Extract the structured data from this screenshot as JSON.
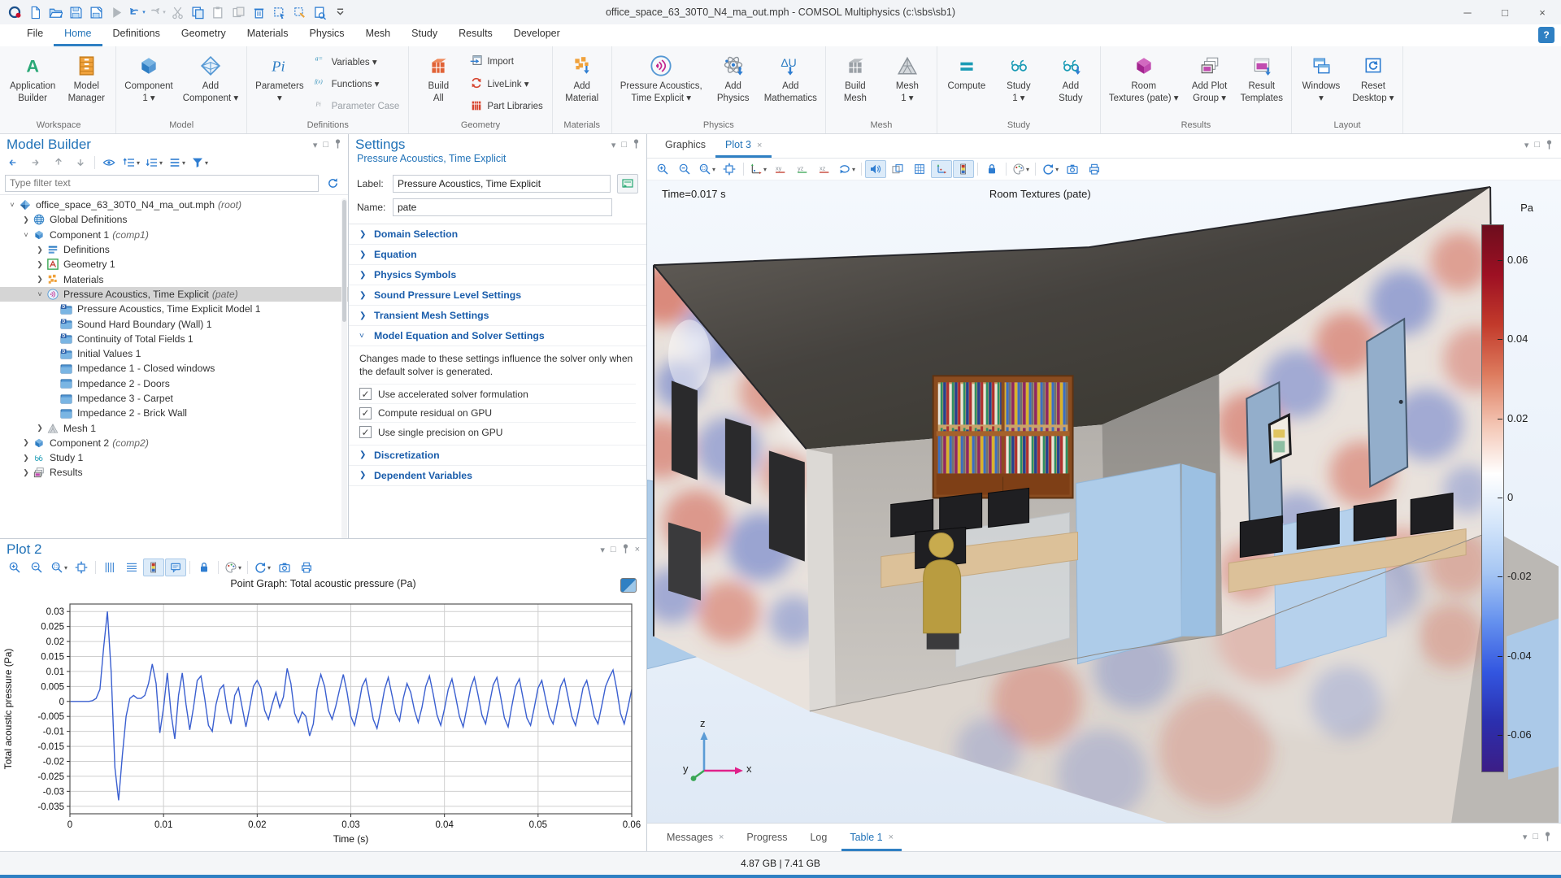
{
  "window": {
    "title": "office_space_63_30T0_N4_ma_out.mph - COMSOL Multiphysics (c:\\sbs\\sb1)",
    "controls": [
      "minimize",
      "maximize",
      "close"
    ],
    "quick_icons": [
      {
        "icon": "comsol-logo"
      },
      {
        "icon": "new-file"
      },
      {
        "icon": "open-file"
      },
      {
        "icon": "save"
      },
      {
        "icon": "save-as"
      },
      {
        "icon": "run",
        "disabled": true
      },
      {
        "icon": "undo",
        "caret": true
      },
      {
        "icon": "redo",
        "caret": true,
        "disabled": true
      },
      {
        "icon": "cut",
        "disabled": true
      },
      {
        "icon": "copy"
      },
      {
        "icon": "paste",
        "disabled": true
      },
      {
        "icon": "duplicate",
        "disabled": true
      },
      {
        "icon": "delete"
      },
      {
        "icon": "select-box"
      },
      {
        "icon": "material-sweep"
      },
      {
        "icon": "preview"
      },
      {
        "icon": "toolbar-options",
        "dark": true
      }
    ]
  },
  "menu": {
    "items": [
      "File",
      "Home",
      "Definitions",
      "Geometry",
      "Materials",
      "Physics",
      "Mesh",
      "Study",
      "Results",
      "Developer"
    ],
    "active": "Home",
    "help": "?"
  },
  "ribbon": {
    "groups": [
      {
        "label": "Workspace",
        "buttons": [
          {
            "icon": "app-builder",
            "label": "Application\nBuilder"
          },
          {
            "icon": "model-manager",
            "label": "Model\nManager"
          }
        ]
      },
      {
        "label": "Model",
        "buttons": [
          {
            "icon": "component",
            "label": "Component\n1 ▾"
          },
          {
            "icon": "add-component",
            "label": "Add\nComponent ▾"
          }
        ]
      },
      {
        "label": "Definitions",
        "buttons": [
          {
            "icon": "parameters",
            "label": "Parameters\n▾"
          }
        ],
        "stack": [
          {
            "icon": "variables",
            "label": "Variables ▾"
          },
          {
            "icon": "functions",
            "label": "Functions ▾"
          },
          {
            "icon": "parameter-case",
            "label": "Parameter Case",
            "disabled": true
          }
        ]
      },
      {
        "label": "Geometry",
        "buttons": [
          {
            "icon": "build-all",
            "label": "Build\nAll"
          }
        ],
        "stack": [
          {
            "icon": "import",
            "label": "Import"
          },
          {
            "icon": "livelink",
            "label": "LiveLink ▾"
          },
          {
            "icon": "part-libraries",
            "label": "Part Libraries"
          }
        ]
      },
      {
        "label": "Materials",
        "buttons": [
          {
            "icon": "add-material",
            "label": "Add\nMaterial"
          }
        ]
      },
      {
        "label": "Physics",
        "buttons": [
          {
            "icon": "pressure-acoustics",
            "label": "Pressure Acoustics,\nTime Explicit ▾"
          },
          {
            "icon": "add-physics",
            "label": "Add\nPhysics"
          },
          {
            "icon": "add-mathematics",
            "label": "Add\nMathematics"
          }
        ]
      },
      {
        "label": "Mesh",
        "buttons": [
          {
            "icon": "build-mesh",
            "label": "Build\nMesh"
          },
          {
            "icon": "mesh",
            "label": "Mesh\n1 ▾"
          }
        ]
      },
      {
        "label": "Study",
        "buttons": [
          {
            "icon": "compute",
            "label": "Compute"
          },
          {
            "icon": "study",
            "label": "Study\n1 ▾"
          },
          {
            "icon": "add-study",
            "label": "Add\nStudy"
          }
        ]
      },
      {
        "label": "Results",
        "buttons": [
          {
            "icon": "room-textures",
            "label": "Room\nTextures (pate) ▾"
          },
          {
            "icon": "add-plot-group",
            "label": "Add Plot\nGroup ▾"
          },
          {
            "icon": "result-templates",
            "label": "Result\nTemplates"
          }
        ]
      },
      {
        "label": "Layout",
        "buttons": [
          {
            "icon": "windows",
            "label": "Windows\n▾"
          },
          {
            "icon": "reset-desktop",
            "label": "Reset\nDesktop ▾"
          }
        ]
      }
    ]
  },
  "model_builder": {
    "title": "Model Builder",
    "toolbar": [
      {
        "icon": "arrow-left"
      },
      {
        "icon": "arrow-right"
      },
      {
        "icon": "arrow-up"
      },
      {
        "icon": "arrow-down"
      },
      {
        "sep": true
      },
      {
        "icon": "eye"
      },
      {
        "icon": "list-up",
        "caret": true
      },
      {
        "icon": "list-down",
        "caret": true
      },
      {
        "icon": "columns",
        "caret": true
      },
      {
        "icon": "filter",
        "caret": true
      }
    ],
    "filter_placeholder": "Type filter text",
    "tree": [
      {
        "label": "office_space_63_30T0_N4_ma_out.mph",
        "suffix": "(root)",
        "level": 0,
        "expand": "v",
        "icon": "model-root"
      },
      {
        "label": "Global Definitions",
        "level": 1,
        "expand": ">",
        "icon": "globe"
      },
      {
        "label": "Component 1",
        "suffix": "(comp1)",
        "level": 1,
        "expand": "v",
        "icon": "component"
      },
      {
        "label": "Definitions",
        "level": 2,
        "expand": ">",
        "icon": "definitions"
      },
      {
        "label": "Geometry 1",
        "level": 2,
        "expand": ">",
        "icon": "geometry"
      },
      {
        "label": "Materials",
        "level": 2,
        "expand": ">",
        "icon": "materials"
      },
      {
        "label": "Pressure Acoustics, Time Explicit",
        "suffix": "(pate)",
        "level": 2,
        "expand": "v",
        "icon": "acoustics",
        "selected": true
      },
      {
        "label": "Pressure Acoustics, Time Explicit Model 1",
        "level": 3,
        "icon": "node-d"
      },
      {
        "label": "Sound Hard Boundary (Wall) 1",
        "level": 3,
        "icon": "node-d"
      },
      {
        "label": "Continuity of Total Fields 1",
        "level": 3,
        "icon": "node-d"
      },
      {
        "label": "Initial Values 1",
        "level": 3,
        "icon": "node-d"
      },
      {
        "label": "Impedance 1 - Closed windows",
        "level": 3,
        "icon": "node"
      },
      {
        "label": "Impedance 2 - Doors",
        "level": 3,
        "icon": "node"
      },
      {
        "label": "Impedance 3 - Carpet",
        "level": 3,
        "icon": "node"
      },
      {
        "label": "Impedance 2 - Brick Wall",
        "level": 3,
        "icon": "node"
      },
      {
        "label": "Mesh 1",
        "level": 2,
        "expand": ">",
        "icon": "mesh-tree"
      },
      {
        "label": "Component 2",
        "suffix": "(comp2)",
        "level": 1,
        "expand": ">",
        "icon": "component"
      },
      {
        "label": "Study 1",
        "level": 1,
        "expand": ">",
        "icon": "study-tree"
      },
      {
        "label": "Results",
        "level": 1,
        "expand": ">",
        "icon": "results-tree"
      }
    ]
  },
  "settings": {
    "title": "Settings",
    "subtitle": "Pressure Acoustics, Time Explicit",
    "label_field": {
      "label": "Label:",
      "value": "Pressure Acoustics, Time Explicit"
    },
    "name_field": {
      "label": "Name:",
      "value": "pate"
    },
    "sections": [
      {
        "label": "Domain Selection"
      },
      {
        "label": "Equation"
      },
      {
        "label": "Physics Symbols"
      },
      {
        "label": "Sound Pressure Level Settings"
      },
      {
        "label": "Transient Mesh Settings"
      },
      {
        "label": "Model Equation and Solver Settings",
        "expanded": true,
        "note": "Changes made to these settings influence the solver only when the default solver is generated.",
        "checkboxes": [
          {
            "label": "Use accelerated solver formulation",
            "checked": true
          },
          {
            "label": "Compute residual on GPU",
            "checked": true
          },
          {
            "label": "Use single precision on GPU",
            "checked": true
          }
        ]
      },
      {
        "label": "Discretization"
      },
      {
        "label": "Dependent Variables"
      }
    ]
  },
  "plot2": {
    "title": "Plot 2",
    "toolbar": [
      {
        "icon": "zoom-in"
      },
      {
        "icon": "zoom-out"
      },
      {
        "icon": "zoom-box",
        "caret": true
      },
      {
        "icon": "zoom-extents"
      },
      {
        "sep": true
      },
      {
        "icon": "grid-v"
      },
      {
        "icon": "grid-h"
      },
      {
        "icon": "color-legend",
        "active": true
      },
      {
        "icon": "plot-labels",
        "active": true
      },
      {
        "sep": true
      },
      {
        "icon": "lock"
      },
      {
        "sep": true
      },
      {
        "icon": "palette",
        "caret": true
      },
      {
        "sep": true
      },
      {
        "icon": "update",
        "caret": true
      },
      {
        "icon": "camera"
      },
      {
        "icon": "print"
      }
    ]
  },
  "chart_data": {
    "type": "line",
    "title": "Point Graph: Total acoustic pressure (Pa)",
    "xlabel": "Time (s)",
    "ylabel": "Total acoustic pressure (Pa)",
    "xlim": [
      0,
      0.06
    ],
    "ylim": [
      -0.0375,
      0.0325
    ],
    "xticks": [
      0,
      0.01,
      0.02,
      0.03,
      0.04,
      0.05,
      0.06
    ],
    "yticks": [
      0.03,
      0.025,
      0.02,
      0.015,
      0.01,
      0.005,
      0,
      -0.005,
      -0.01,
      -0.015,
      -0.02,
      -0.025,
      -0.03,
      -0.035
    ],
    "grid": true,
    "series": [
      {
        "name": "Total acoustic pressure",
        "color": "#3a5fd0",
        "t0": 0,
        "dt": 0.0004,
        "values": [
          0,
          0,
          0,
          0,
          0,
          0,
          0.0002,
          0.001,
          0.004,
          0.018,
          0.03,
          0.01,
          -0.022,
          -0.033,
          -0.018,
          -0.005,
          0.001,
          0.002,
          0.001,
          0.001,
          0.002,
          0.006,
          0.0125,
          0.006,
          -0.0105,
          -0.002,
          0.0095,
          -0.004,
          -0.0125,
          0.002,
          0.0095,
          -0.001,
          -0.0095,
          -0.002,
          0.007,
          0.0085,
          0.001,
          -0.008,
          -0.01,
          -0.001,
          0.004,
          0.0055,
          -0.003,
          -0.0075,
          0.002,
          0.0045,
          -0.002,
          -0.0085,
          -0.002,
          0.005,
          0.007,
          0.0045,
          -0.003,
          -0.006,
          -0.001,
          0.003,
          -0.002,
          0.0015,
          0.011,
          0.006,
          -0.004,
          -0.007,
          -0.0035,
          -0.005,
          -0.0115,
          -0.0075,
          0.004,
          0.009,
          0.005,
          -0.003,
          -0.006,
          -0.0015,
          0.004,
          0.009,
          0.003,
          -0.005,
          -0.008,
          -0.002,
          0.005,
          0.0075,
          0.001,
          -0.006,
          -0.009,
          -0.003,
          0.004,
          0.008,
          0.002,
          -0.004,
          -0.0065,
          0.001,
          0.006,
          0.003,
          -0.003,
          -0.007,
          -0.002,
          0.005,
          0.0085,
          0.0025,
          -0.0045,
          -0.008,
          -0.0025,
          0.004,
          0.0075,
          0.0015,
          -0.005,
          -0.0085,
          -0.002,
          0.0045,
          0.008,
          0.002,
          -0.0045,
          -0.0075,
          -0.001,
          0.0055,
          0.008,
          0.0015,
          -0.0055,
          -0.0085,
          -0.0015,
          0.005,
          0.0075,
          0.001,
          -0.0055,
          -0.008,
          -0.002,
          0.0045,
          0.007,
          0.001,
          -0.005,
          -0.0075,
          -0.0015,
          0.005,
          0.0075,
          0.0015,
          -0.005,
          -0.008,
          -0.002,
          0.0045,
          0.007,
          0.0015,
          -0.005,
          -0.0075,
          -0.0015,
          0.005,
          0.008,
          0.0105,
          0.004,
          -0.004,
          -0.0075,
          -0.002,
          0.004
        ]
      }
    ]
  },
  "graphics": {
    "tabs": [
      {
        "label": "Graphics"
      },
      {
        "label": "Plot 3",
        "active": true,
        "closable": true
      }
    ],
    "toolbar": [
      {
        "icon": "zoom-in"
      },
      {
        "icon": "zoom-out"
      },
      {
        "icon": "zoom-box",
        "caret": true
      },
      {
        "icon": "zoom-extents"
      },
      {
        "sep": true
      },
      {
        "icon": "go-to-view",
        "caret": true
      },
      {
        "icon": "view-xy"
      },
      {
        "icon": "view-yz"
      },
      {
        "icon": "view-xz"
      },
      {
        "icon": "rotate",
        "caret": true
      },
      {
        "sep": true
      },
      {
        "icon": "sound",
        "active": true
      },
      {
        "icon": "scene"
      },
      {
        "icon": "grid-cells"
      },
      {
        "icon": "show-axis",
        "active": true
      },
      {
        "icon": "color-legend",
        "active": true
      },
      {
        "sep": true
      },
      {
        "icon": "lock"
      },
      {
        "sep": true
      },
      {
        "icon": "palette",
        "caret": true
      },
      {
        "sep": true
      },
      {
        "icon": "update",
        "caret": true
      },
      {
        "icon": "camera"
      },
      {
        "icon": "print"
      }
    ],
    "time_label": "Time=0.017 s",
    "plot_title": "Room Textures (pate)",
    "colorbar": {
      "unit": "Pa",
      "max": 0.069,
      "min": -0.069,
      "ticks": [
        0.06,
        0.04,
        0.02,
        0,
        -0.02,
        -0.04,
        -0.06
      ],
      "colors": [
        "#6d0d1d",
        "#9d1023",
        "#c23a2b",
        "#dd7b5e",
        "#f3c4b2",
        "#ffffff",
        "#d5e6fa",
        "#a6c6f3",
        "#6490ee",
        "#3356e0",
        "#2b2fae",
        "#3c1d86"
      ]
    },
    "axes": {
      "x": "x",
      "y": "y",
      "z": "z"
    }
  },
  "bottom": {
    "tabs": [
      {
        "label": "Messages",
        "closable": true
      },
      {
        "label": "Progress"
      },
      {
        "label": "Log"
      },
      {
        "label": "Table 1",
        "closable": true,
        "active": true
      }
    ],
    "status": "4.87 GB | 7.41 GB"
  }
}
